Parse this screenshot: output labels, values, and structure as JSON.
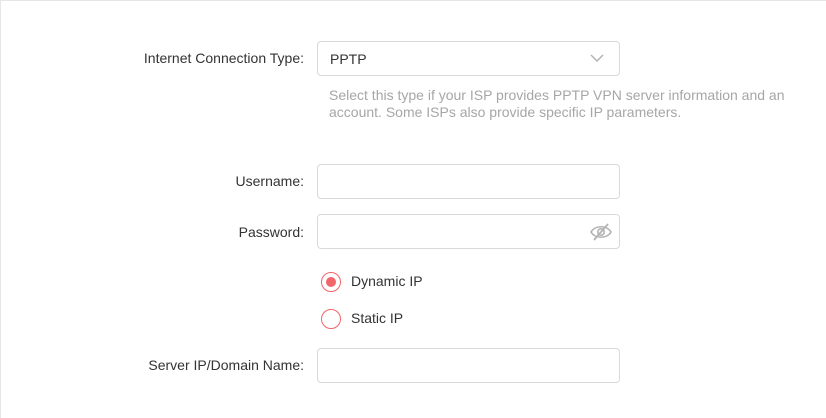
{
  "form": {
    "connection_type": {
      "label": "Internet Connection Type:",
      "selected": "PPTP",
      "hint": "Select this type if your ISP provides PPTP VPN server information and an account. Some ISPs also provide specific IP parameters."
    },
    "username": {
      "label": "Username:",
      "value": ""
    },
    "password": {
      "label": "Password:",
      "value": "",
      "visibility_icon": "eye-slash-icon"
    },
    "ip_mode": {
      "options": [
        {
          "label": "Dynamic IP",
          "checked": true
        },
        {
          "label": "Static IP",
          "checked": false
        }
      ]
    },
    "server": {
      "label": "Server IP/Domain Name:",
      "value": ""
    }
  },
  "colors": {
    "accent": "#f0666a",
    "text": "#333333",
    "hint": "#a6a6a6",
    "border": "#d9d9d9"
  }
}
